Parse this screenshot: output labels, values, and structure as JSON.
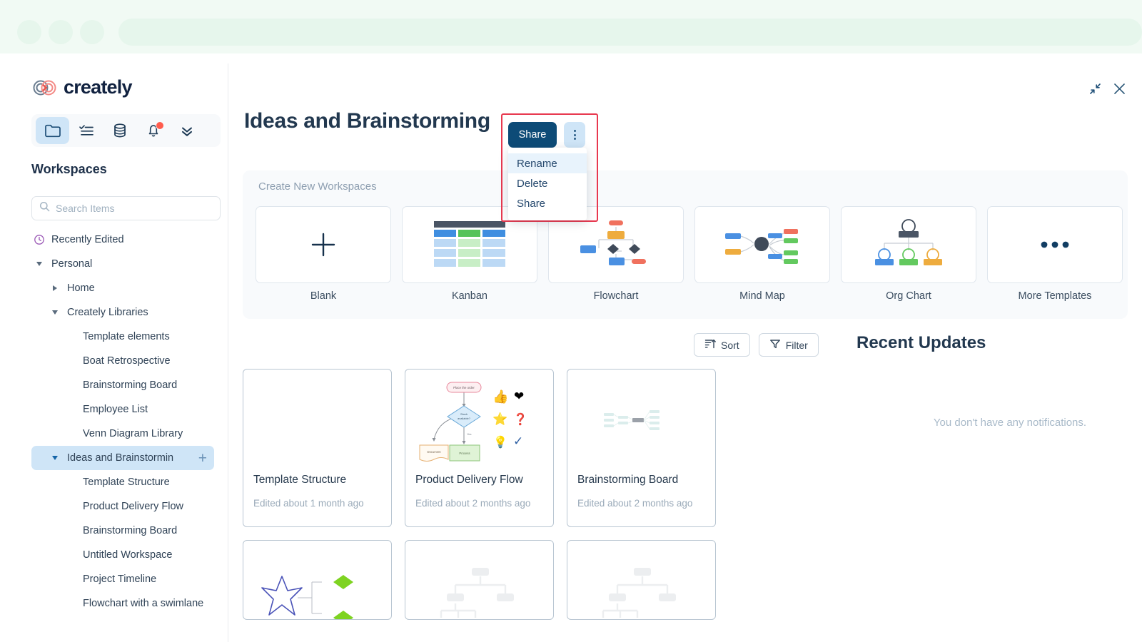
{
  "browser": {
    "dot_count": 3,
    "urlbar_value": ""
  },
  "sidebar": {
    "logo_text": "creately",
    "toolbar": [
      {
        "name": "folder-icon",
        "label": "Workspaces",
        "active": true,
        "badge": false
      },
      {
        "name": "checklist-icon",
        "label": "Tasks",
        "active": false,
        "badge": false
      },
      {
        "name": "database-icon",
        "label": "Data",
        "active": false,
        "badge": false
      },
      {
        "name": "bell-icon",
        "label": "Notifications",
        "active": false,
        "badge": true
      },
      {
        "name": "chevron-double-down-icon",
        "label": "More",
        "active": false,
        "badge": false
      }
    ],
    "section_title": "Workspaces",
    "search": {
      "placeholder": "Search Items",
      "value": ""
    },
    "tree": [
      {
        "label": "Recently Edited",
        "indent": 0,
        "caret": "none",
        "icon": "clock-icon",
        "selected": false,
        "plus": false
      },
      {
        "label": "Personal",
        "indent": 0,
        "caret": "down",
        "icon": "none",
        "selected": false,
        "plus": false
      },
      {
        "label": "Home",
        "indent": 1,
        "caret": "right",
        "icon": "none",
        "selected": false,
        "plus": false
      },
      {
        "label": "Creately Libraries",
        "indent": 1,
        "caret": "down",
        "icon": "none",
        "selected": false,
        "plus": false
      },
      {
        "label": "Template elements",
        "indent": 2,
        "caret": "none",
        "icon": "none",
        "selected": false,
        "plus": false
      },
      {
        "label": "Boat Retrospective",
        "indent": 2,
        "caret": "none",
        "icon": "none",
        "selected": false,
        "plus": false
      },
      {
        "label": "Brainstorming Board",
        "indent": 2,
        "caret": "none",
        "icon": "none",
        "selected": false,
        "plus": false
      },
      {
        "label": "Employee List",
        "indent": 2,
        "caret": "none",
        "icon": "none",
        "selected": false,
        "plus": false
      },
      {
        "label": "Venn Diagram Library",
        "indent": 2,
        "caret": "none",
        "icon": "none",
        "selected": false,
        "plus": false
      },
      {
        "label": "Ideas and Brainstormin",
        "indent": 1,
        "caret": "down-blue",
        "icon": "none",
        "selected": true,
        "plus": true
      },
      {
        "label": "Template Structure",
        "indent": 2,
        "caret": "none",
        "icon": "none",
        "selected": false,
        "plus": false
      },
      {
        "label": "Product Delivery Flow",
        "indent": 2,
        "caret": "none",
        "icon": "none",
        "selected": false,
        "plus": false
      },
      {
        "label": "Brainstorming Board",
        "indent": 2,
        "caret": "none",
        "icon": "none",
        "selected": false,
        "plus": false
      },
      {
        "label": "Untitled Workspace",
        "indent": 2,
        "caret": "none",
        "icon": "none",
        "selected": false,
        "plus": false
      },
      {
        "label": "Project Timeline",
        "indent": 2,
        "caret": "none",
        "icon": "none",
        "selected": false,
        "plus": false
      },
      {
        "label": "Flowchart with a swimlane",
        "indent": 2,
        "caret": "none",
        "icon": "none",
        "selected": false,
        "plus": false
      }
    ]
  },
  "header": {
    "title": "Ideas and Brainstorming",
    "share_label": "Share",
    "kebab_name": "more-options-icon",
    "window_controls": [
      {
        "name": "collapse-icon"
      },
      {
        "name": "close-icon"
      }
    ]
  },
  "context_menu": {
    "items": [
      {
        "label": "Rename",
        "hover": true
      },
      {
        "label": "Delete",
        "hover": false
      },
      {
        "label": "Share",
        "hover": false
      }
    ]
  },
  "create_panel": {
    "title": "Create New Workspaces",
    "templates": [
      {
        "label": "Blank",
        "thumb": "plus"
      },
      {
        "label": "Kanban",
        "thumb": "kanban"
      },
      {
        "label": "Flowchart",
        "thumb": "flowchart"
      },
      {
        "label": "Mind Map",
        "thumb": "mindmap"
      },
      {
        "label": "Org Chart",
        "thumb": "orgchart"
      },
      {
        "label": "More Templates",
        "thumb": "ellipsis"
      }
    ]
  },
  "toolbar": {
    "sort_label": "Sort",
    "filter_label": "Filter"
  },
  "recent_updates": {
    "title": "Recent Updates",
    "empty_text": "You don't have any notifications."
  },
  "documents": [
    {
      "name": "Template Structure",
      "meta": "Edited about 1 month ago",
      "thumb": "empty",
      "partial": false
    },
    {
      "name": "Product Delivery Flow",
      "meta": "Edited about 2 months ago",
      "thumb": "delivery-flow",
      "partial": false
    },
    {
      "name": "Brainstorming Board",
      "meta": "Edited about 2 months ago",
      "thumb": "faint-mindmap",
      "partial": false
    },
    {
      "name": "",
      "meta": "",
      "thumb": "star-diagram",
      "partial": true
    },
    {
      "name": "",
      "meta": "",
      "thumb": "grey-orgchart",
      "partial": true
    },
    {
      "name": "",
      "meta": "",
      "thumb": "grey-orgchart",
      "partial": true
    }
  ],
  "colors": {
    "accent_navy": "#0d4b77",
    "highlight_red": "#e8384f",
    "selection_blue": "#cfe5f7",
    "notification_red": "#ff5c4d",
    "chrome_green": "#f1faf4",
    "text_dark": "#22384f",
    "text_muted": "#9aaab9"
  }
}
